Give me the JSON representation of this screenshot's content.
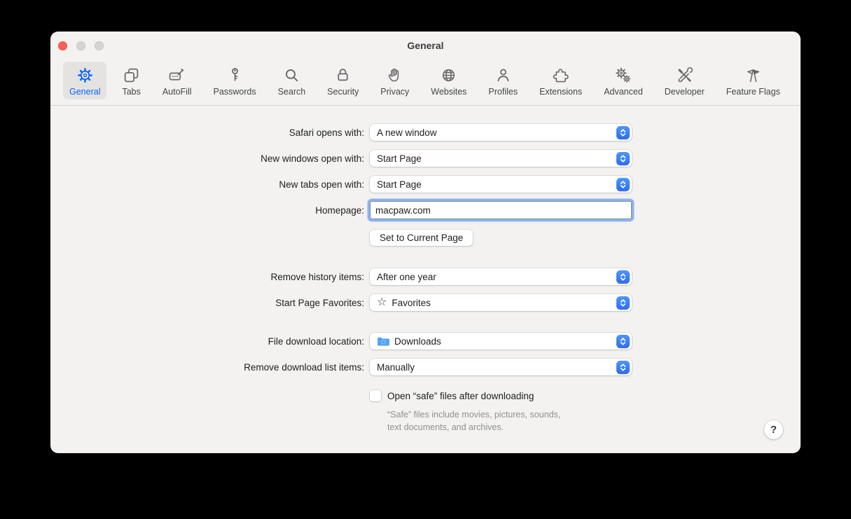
{
  "window": {
    "title": "General"
  },
  "toolbar": {
    "items": [
      {
        "label": "General",
        "selected": true
      },
      {
        "label": "Tabs",
        "selected": false
      },
      {
        "label": "AutoFill",
        "selected": false
      },
      {
        "label": "Passwords",
        "selected": false
      },
      {
        "label": "Search",
        "selected": false
      },
      {
        "label": "Security",
        "selected": false
      },
      {
        "label": "Privacy",
        "selected": false
      },
      {
        "label": "Websites",
        "selected": false
      },
      {
        "label": "Profiles",
        "selected": false
      },
      {
        "label": "Extensions",
        "selected": false
      },
      {
        "label": "Advanced",
        "selected": false
      },
      {
        "label": "Developer",
        "selected": false
      },
      {
        "label": "Feature Flags",
        "selected": false
      }
    ]
  },
  "form": {
    "rows": [
      {
        "label": "Safari opens with:",
        "value": "A new window"
      },
      {
        "label": "New windows open with:",
        "value": "Start Page"
      },
      {
        "label": "New tabs open with:",
        "value": "Start Page"
      }
    ],
    "homepage": {
      "label": "Homepage:",
      "value": "macpaw.com"
    },
    "set_current_button": "Set to Current Page",
    "history_row": {
      "label": "Remove history items:",
      "value": "After one year"
    },
    "favorites_row": {
      "label": "Start Page Favorites:",
      "value": "Favorites",
      "icon": "star-icon"
    },
    "download_location_row": {
      "label": "File download location:",
      "value": "Downloads",
      "icon": "folder-icon"
    },
    "download_list_row": {
      "label": "Remove download list items:",
      "value": "Manually"
    },
    "safe_checkbox": {
      "label": "Open “safe” files after downloading",
      "checked": false
    },
    "safe_note_line1": "“Safe” files include movies, pictures, sounds,",
    "safe_note_line2": "text documents, and archives.",
    "help_button": "?"
  },
  "colors": {
    "accent_blue": "#2e7bf6",
    "selected_tab_blue": "#0a63ff",
    "window_bg": "#f3f2f0",
    "traffic_red": "#fc5f57",
    "traffic_gray": "#d5d4d2",
    "folder_blue": "#55a4f3"
  }
}
